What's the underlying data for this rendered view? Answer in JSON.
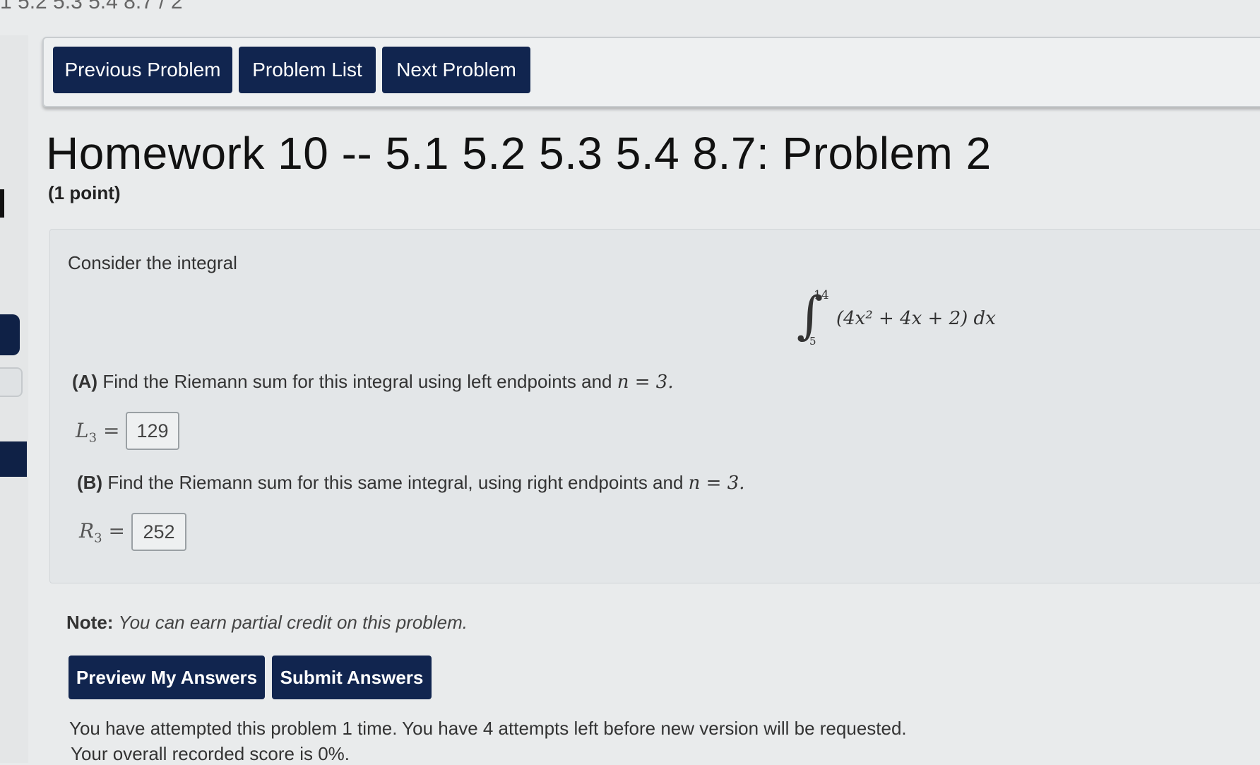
{
  "breadcrumb": {
    "text": "1 5.2 5.3 5.4 8.7 / 2"
  },
  "nav": {
    "previous_label": "Previous Problem",
    "list_label": "Problem List",
    "next_label": "Next Problem"
  },
  "header": {
    "title": "Homework 10 -- 5.1 5.2 5.3 5.4 8.7: Problem 2",
    "points": "(1 point)"
  },
  "problem": {
    "intro": "Consider the integral",
    "integral": {
      "upper": "14",
      "lower": "5",
      "integrand": "(4x² + 4x + 2) dx"
    },
    "part_a": {
      "tag": "(A)",
      "text": " Find the Riemann sum for this integral using left endpoints and ",
      "n_expr": "n = 3.",
      "label": "L",
      "label_sub": "3",
      "equals": " = ",
      "answer": "129"
    },
    "part_b": {
      "tag": "(B)",
      "text": " Find the Riemann sum for this same integral, using right endpoints and ",
      "n_expr": "n = 3.",
      "label": "R",
      "label_sub": "3",
      "equals": " = ",
      "answer": "252"
    }
  },
  "note": {
    "label": "Note:",
    "text": "You can earn partial credit on this problem."
  },
  "actions": {
    "preview_label": "Preview My Answers",
    "submit_label": "Submit Answers"
  },
  "status": {
    "attempts": "You have attempted this problem 1 time. You have 4 attempts left before new version will be requested.",
    "score": "Your overall recorded score is 0%."
  },
  "colors": {
    "button_bg": "#11254f",
    "page_bg": "#e9ebec"
  }
}
